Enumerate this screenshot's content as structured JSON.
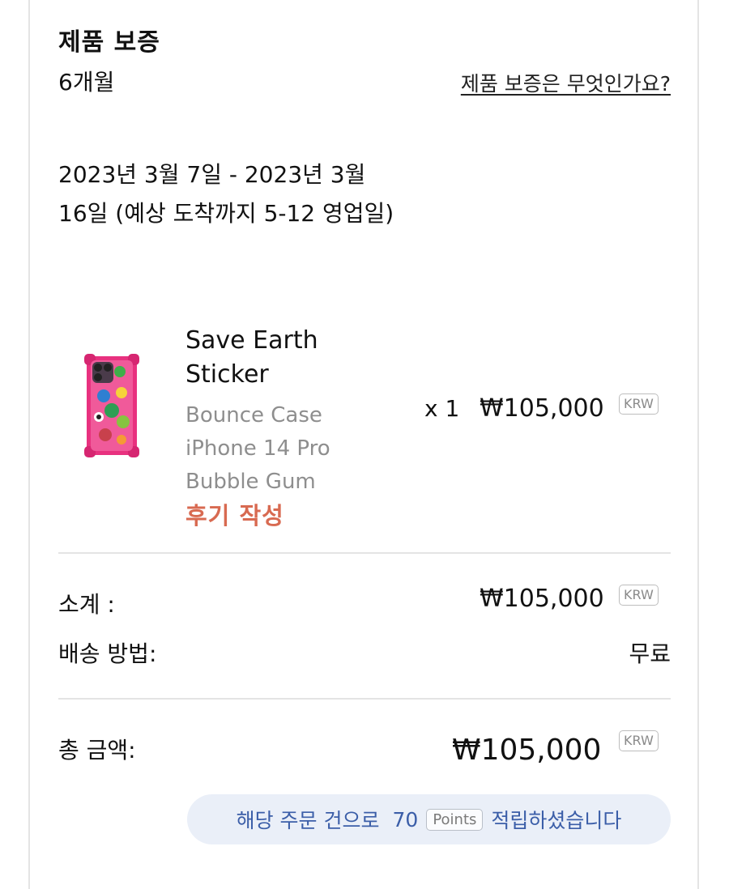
{
  "warranty": {
    "title": "제품 보증",
    "value": "6개월",
    "link_label": "제품 보증은 무엇인가요?"
  },
  "delivery": {
    "estimate": "2023년 3월 7일 - 2023년 3월 16일 (예상 도착까지 5-12 영업일)"
  },
  "product": {
    "image_icon": "phone-case-thumbnail",
    "name": "Save Earth Sticker",
    "variant_line1": "Bounce Case",
    "variant_line2": "iPhone 14 Pro",
    "variant_line3": "Bubble Gum",
    "review_label": "후기 작성",
    "quantity": "x 1",
    "price": "₩105,000",
    "currency": "KRW"
  },
  "summary": {
    "subtotal_label": "소계 :",
    "subtotal_value": "₩105,000",
    "subtotal_currency": "KRW",
    "shipping_label": "배송 방법:",
    "shipping_value": "무료",
    "total_label": "총 금액:",
    "total_value": "₩105,000",
    "total_currency": "KRW"
  },
  "points": {
    "prefix": "해당 주문 건으로",
    "amount": "70",
    "unit": "Points",
    "suffix": "적립하셨습니다"
  },
  "colors": {
    "review_accent": "#d86a51",
    "points_text": "#3b5ea8",
    "points_bg": "#eaeff8"
  }
}
